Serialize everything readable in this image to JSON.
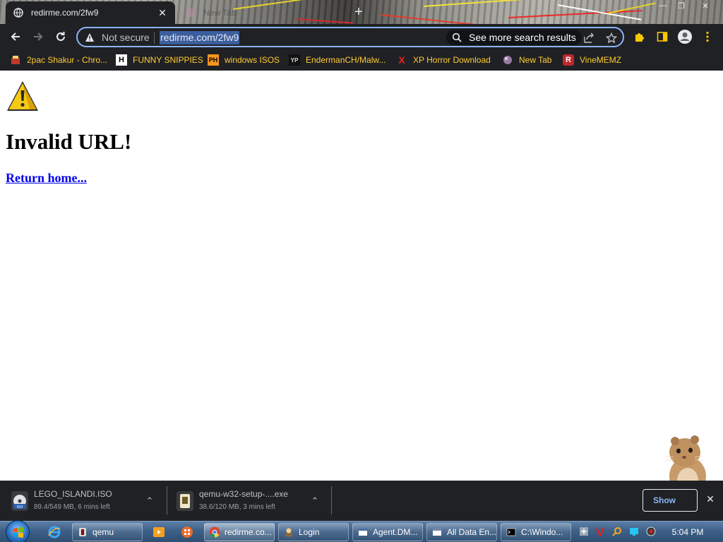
{
  "browser": {
    "tabs": [
      {
        "title": "redirme.com/2fw9",
        "active": true
      },
      {
        "title": "New Tab",
        "active": false
      }
    ],
    "address_bar": {
      "security_label": "Not secure",
      "url": "redirme.com/2fw9",
      "search_chip": "See more search results"
    },
    "bookmarks": [
      {
        "label": "2pac Shakur - Chro...",
        "icon": "red-box-icon"
      },
      {
        "label": "FUNNY SNIPPIES",
        "icon": "H",
        "icon_name": "h-logo-icon"
      },
      {
        "label": "windows ISOS",
        "icon": "PH",
        "icon_name": "ph-logo-icon"
      },
      {
        "label": "EndermanCH/Malw...",
        "icon": "YP",
        "icon_name": "yp-logo-icon"
      },
      {
        "label": "XP Horror Download",
        "icon": "X",
        "icon_name": "x-logo-icon"
      },
      {
        "label": "New Tab",
        "icon": "globe-icon"
      },
      {
        "label": "VineMEMZ",
        "icon": "R",
        "icon_name": "r-logo-icon"
      }
    ]
  },
  "page": {
    "heading": "Invalid URL!",
    "link": "Return home..."
  },
  "downloads": {
    "items": [
      {
        "name": "LEGO_ISLANDI.ISO",
        "progress": "89.4/549 MB, 6 mins left"
      },
      {
        "name": "qemu-w32-setup-....exe",
        "progress": "38.6/120 MB, 3 mins left"
      }
    ],
    "show_all_label": "Show"
  },
  "taskbar": {
    "buttons": [
      {
        "label": "qemu"
      },
      {
        "label": "redirme.co...",
        "active": true
      },
      {
        "label": "Login"
      },
      {
        "label": "Agent.DM..."
      },
      {
        "label": "All Data En..."
      },
      {
        "label": "C:\\Windo..."
      }
    ],
    "clock": "5:04 PM"
  },
  "colors": {
    "chrome_dark": "#202124",
    "bookmark_text": "#ffcc33",
    "focus_ring": "#8ab4f8",
    "link": "#0000ee"
  }
}
